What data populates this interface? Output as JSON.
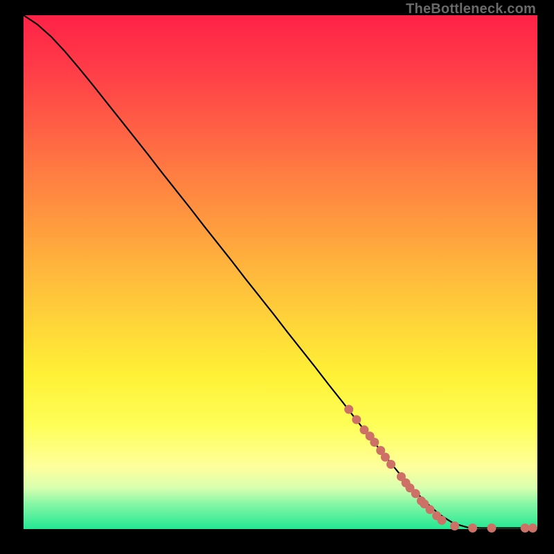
{
  "watermark": "TheBottleneck.com",
  "chart_data": {
    "type": "line",
    "title": "",
    "xlabel": "",
    "ylabel": "",
    "xlim": [
      0,
      100
    ],
    "ylim": [
      0,
      100
    ],
    "grid": false,
    "legend": false,
    "series": [
      {
        "name": "curve",
        "color": "#000000",
        "x": [
          0,
          2.7,
          5.4,
          8.1,
          10.8,
          13.5,
          16.2,
          18.9,
          21.6,
          24.3,
          27.0,
          29.7,
          32.4,
          35.1,
          37.8,
          40.5,
          43.2,
          45.9,
          48.6,
          51.3,
          54.0,
          56.7,
          59.4,
          62.1,
          64.8,
          67.5,
          70.2,
          72.9,
          75.6,
          78.3,
          81.0,
          83.7,
          86.5,
          89.2,
          91.9,
          94.6,
          97.3,
          100.0
        ],
        "y": [
          100.0,
          98.2,
          95.8,
          92.9,
          89.7,
          86.4,
          83.0,
          79.6,
          76.2,
          72.8,
          69.3,
          65.9,
          62.5,
          59.0,
          55.6,
          52.2,
          48.7,
          45.3,
          41.9,
          38.4,
          35.0,
          31.6,
          28.1,
          24.7,
          21.2,
          17.8,
          14.4,
          11.1,
          8.0,
          5.2,
          2.8,
          1.1,
          0.3,
          0.2,
          0.2,
          0.2,
          0.2,
          0.2
        ]
      },
      {
        "name": "scatter-points",
        "color": "#cd7166",
        "marker": "circle",
        "radius": 6.5,
        "x": [
          63.3,
          64.8,
          66.3,
          67.4,
          68.3,
          69.5,
          70.4,
          71.5,
          73.5,
          74.4,
          75.2,
          76.3,
          77.4,
          78.0,
          79.1,
          80.4,
          81.4,
          83.9,
          87.4,
          91.1,
          97.6,
          99.1
        ],
        "y": [
          23.3,
          21.3,
          19.3,
          18.1,
          16.9,
          15.3,
          14.0,
          12.6,
          10.2,
          9.0,
          8.0,
          6.9,
          5.5,
          4.9,
          3.8,
          2.6,
          1.7,
          0.6,
          0.2,
          0.2,
          0.2,
          0.2
        ]
      }
    ],
    "marker_radius": 6.5,
    "marker_color": "#cd7166",
    "line_color": "#000000"
  }
}
